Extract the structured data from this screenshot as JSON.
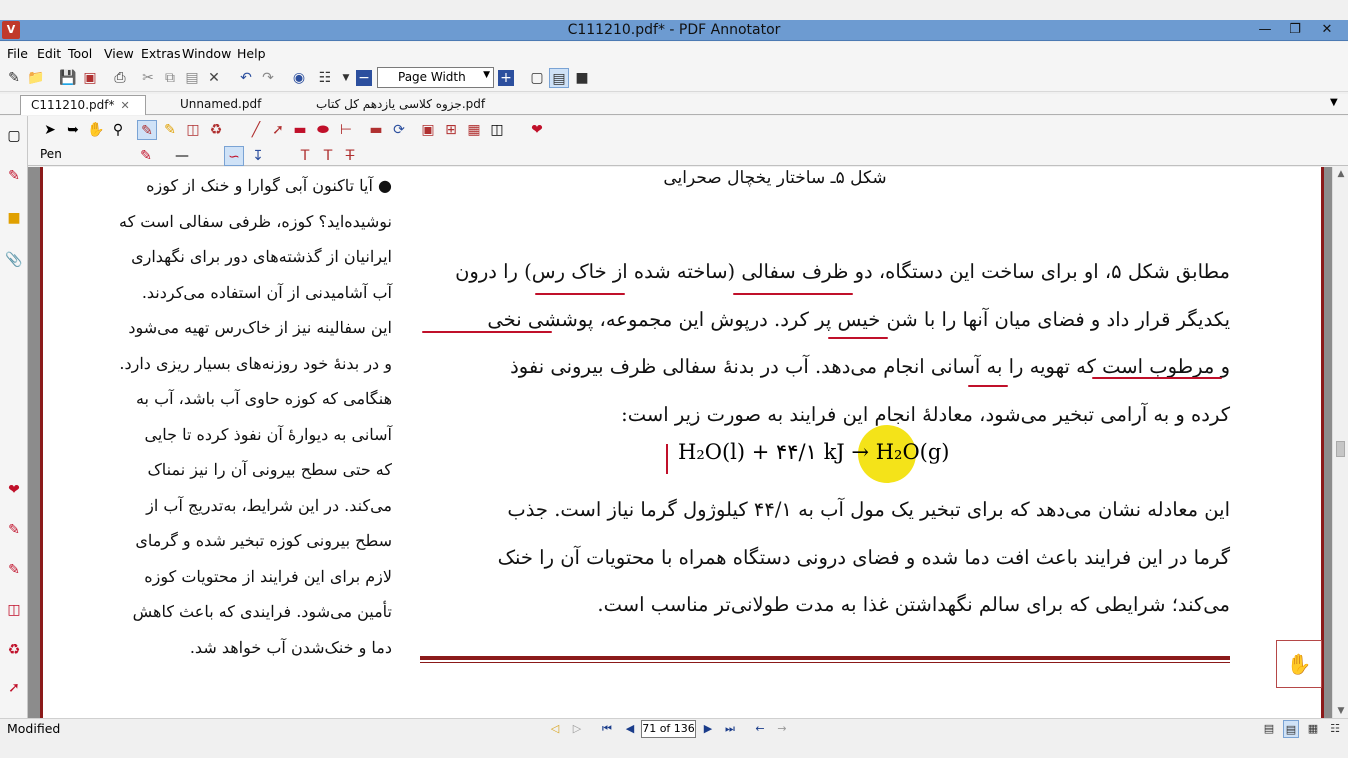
{
  "window": {
    "title": "C111210.pdf* - PDF Annotator",
    "app_icon": "pdf-annotator-logo"
  },
  "menu": [
    "File",
    "Edit",
    "Tool",
    "View",
    "Extras",
    "Window",
    "Help"
  ],
  "toolbar": {
    "zoom_value": "Page Width"
  },
  "tabs": [
    {
      "label": "C111210.pdf*",
      "active": true
    },
    {
      "label": "Unnamed.pdf",
      "active": false
    },
    {
      "label": "جزوه کلاسی یازدهم کل کتاب.pdf",
      "active": false
    }
  ],
  "tool": {
    "current": "Pen"
  },
  "document": {
    "figure_caption": "شکل ۵ـ ساختار یخچال صحرایی",
    "left_column": [
      "● آیا تاکنون آبی گوارا و خنک از کوزه",
      "نوشیده‌اید؟ کوزه، ظرفی سفالی است که",
      "ایرانیان از گذشته‌های دور برای نگهداری",
      "آب آشامیدنی از آن استفاده می‌کردند.",
      "این سفالینه نیز از خاک‌رس تهیه می‌شود",
      "و در بدنهٔ خود روزنه‌های بسیار ریزی دارد.",
      "هنگامی که کوزه حاوی آب باشد، آب به",
      "آسانی به دیوارهٔ آن نفوذ کرده تا جایی",
      "که حتی سطح بیرونی آن را نیز نمناک",
      "می‌کند. در این شرایط، به‌تدریج آب از",
      "سطح بیرونی کوزه تبخیر شده و گرمای",
      "لازم برای این فرایند از محتویات کوزه",
      "تأمین می‌شود. فرایندی که باعث کاهش",
      "دما و خنک‌شدن آب خواهد شد."
    ],
    "main_lines": [
      "مطابق شکل ۵، او برای ساخت این دستگاه، دو ظرف سفالی (ساخته شده از خاک رس) را درون",
      "یکدیگر قرار داد و فضای میان آنها را با شن خیس پر کرد. درپوش این مجموعه، پوششی نخی",
      "و مرطوب است که تهویه را به آسانی انجام می‌دهد. آب در بدنهٔ سفالی ظرف بیرونی نفوذ",
      "کرده و به آرامی تبخیر می‌شود، معادلهٔ انجام این فرایند به صورت زیر است:"
    ],
    "equation": {
      "left": "H₂O(l) + ۴۴/۱ kJ",
      "arrow": "→",
      "right": "H₂O(g)"
    },
    "main_lines2": [
      "این معادله نشان می‌دهد که برای تبخیر یک مول آب به ۴۴/۱ کیلوژول گرما نیاز است. جذب",
      "گرما در این فرایند باعث افت دما شده و فضای درونی دستگاه همراه با محتویات آن را خنک",
      "می‌کند؛ شرایطی که برای سالم نگهداشتن غذا به مدت طولانی‌تر مناسب است."
    ]
  },
  "status": {
    "text": "Modified",
    "page_indicator": "71 of 136"
  },
  "colors": {
    "titlebar": "#6d9bd1",
    "annotation_red": "#c0102a",
    "page_border": "#8b1a1a",
    "highlight": "#f3e000"
  }
}
